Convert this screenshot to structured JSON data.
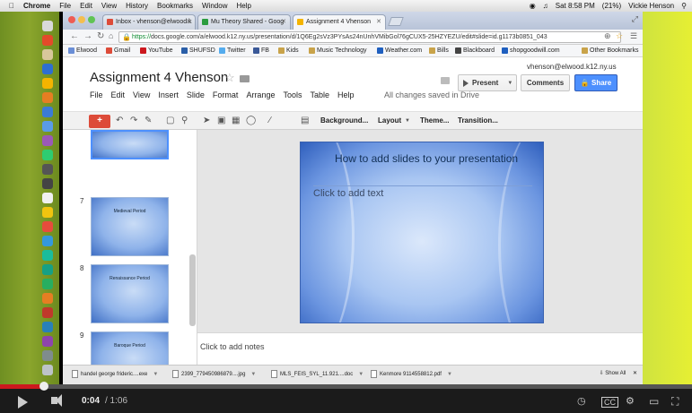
{
  "mac_menu": {
    "items": [
      "Chrome",
      "File",
      "Edit",
      "View",
      "History",
      "Bookmarks",
      "Window",
      "Help"
    ],
    "clock": "Sat 8:58 PM",
    "battery": "(21%)",
    "user": "Vickie Henson"
  },
  "tabs": [
    {
      "label": "Inbox - vhenson@elwood.k",
      "fav_color": "#dd4b39"
    },
    {
      "label": "Mu Theory Shared - Goog",
      "fav_color": "#2a9c3f"
    },
    {
      "label": "Assignment 4 Vhenson",
      "fav_color": "#f4b400",
      "active": true
    }
  ],
  "address_bar": {
    "scheme": "https://",
    "url": "docs.google.com/a/elwood.k12.ny.us/presentation/d/1Q6Eg2sVz3PYsAs24nUnhVMibGol76gCUX5-25HZYEZU/edit#slide=id.g1173b0851_043"
  },
  "bookmarks": [
    {
      "label": "Elwood",
      "color": "#6a8ed6"
    },
    {
      "label": "Gmail",
      "color": "#dd4b39"
    },
    {
      "label": "YouTube",
      "color": "#cc181e"
    },
    {
      "label": "SHUFSD",
      "color": "#2b5fa8"
    },
    {
      "label": "Twitter",
      "color": "#55acee"
    },
    {
      "label": "FB",
      "color": "#3b5998"
    },
    {
      "label": "Kids",
      "color": "#c9a34a"
    },
    {
      "label": "Music Technology",
      "color": "#c9a34a"
    },
    {
      "label": "Weather.com",
      "color": "#1f5fbf"
    },
    {
      "label": "Bills",
      "color": "#c9a34a"
    },
    {
      "label": "Blackboard",
      "color": "#444444"
    },
    {
      "label": "shopgoodwill.com",
      "color": "#1f5fbf"
    },
    {
      "label": "Other Bookmarks",
      "color": "#c9a34a"
    }
  ],
  "doc": {
    "title": "Assignment 4 Vhenson",
    "user_email": "vhenson@elwood.k12.ny.us",
    "menu": [
      "File",
      "Edit",
      "View",
      "Insert",
      "Slide",
      "Format",
      "Arrange",
      "Tools",
      "Table",
      "Help"
    ],
    "saved_status": "All changes saved in Drive",
    "present_label": "Present",
    "comments_label": "Comments",
    "share_label": "Share"
  },
  "toolbar": {
    "new_slide": "+",
    "background": "Background...",
    "layout": "Layout",
    "theme": "Theme...",
    "transition": "Transition..."
  },
  "slides_panel": [
    {
      "number": "",
      "title": ""
    },
    {
      "number": "7",
      "title": "Medieval Period"
    },
    {
      "number": "8",
      "title": "Renaissance Period"
    },
    {
      "number": "9",
      "title": "Baroque Period"
    }
  ],
  "current_slide": {
    "title": "How to add slides to your presentation",
    "body_placeholder": "Click to add text"
  },
  "notes_placeholder": "Click to add notes",
  "downloads": [
    "handel george frideric....exe",
    "2399_779450986879....jpg",
    "MLS_FEIS_SYL_11.921....doc",
    "Kenmore 9114558812.pdf"
  ],
  "show_all": "Show All",
  "video": {
    "current_time": "0:04",
    "total_time": "/ 1:06",
    "progress_fraction": 0.063
  },
  "colors": {
    "dock_green": "#8aa52c",
    "share_blue": "#4d90fe",
    "new_slide_red": "#dd4b39",
    "progress_red": "#cc181e"
  }
}
